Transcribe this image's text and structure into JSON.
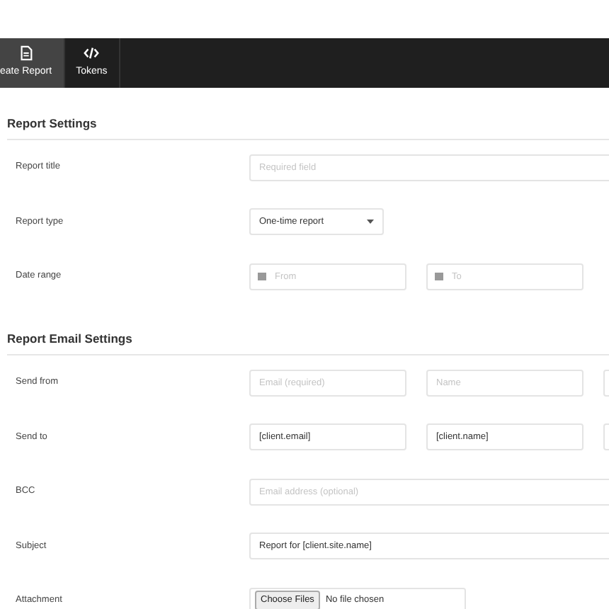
{
  "tabs": [
    {
      "label": "eate Report",
      "selected": true
    },
    {
      "label": "Tokens",
      "selected": false
    }
  ],
  "sections": [
    {
      "title": "Report Settings",
      "rows": [
        {
          "label": "Report title",
          "fields": [
            {
              "kind": "text",
              "placeholder": "Required field"
            }
          ]
        },
        {
          "label": "Report type",
          "fields": [
            {
              "kind": "select",
              "value": "One-time report"
            }
          ]
        },
        {
          "label": "Date range",
          "fields": [
            {
              "kind": "date",
              "placeholder": "From"
            },
            {
              "kind": "date",
              "placeholder": "To"
            }
          ]
        }
      ]
    },
    {
      "title": "Report Email Settings",
      "rows": [
        {
          "label": "Send from",
          "fields": [
            {
              "kind": "text",
              "placeholder": "Email (required)"
            },
            {
              "kind": "text",
              "placeholder": "Name"
            },
            {
              "kind": "text"
            }
          ]
        },
        {
          "label": "Send to",
          "fields": [
            {
              "kind": "text",
              "value": "[client.email]"
            },
            {
              "kind": "text",
              "value": "[client.name]"
            },
            {
              "kind": "text"
            }
          ]
        },
        {
          "label": "BCC",
          "fields": [
            {
              "kind": "text",
              "placeholder": "Email address (optional)"
            }
          ]
        },
        {
          "label": "Subject",
          "fields": [
            {
              "kind": "text",
              "value": "Report for [client.site.name]"
            }
          ]
        },
        {
          "label": "Attachment",
          "fields": [
            {
              "kind": "file",
              "button": "Choose Files",
              "value": "No file chosen"
            }
          ]
        }
      ]
    }
  ]
}
